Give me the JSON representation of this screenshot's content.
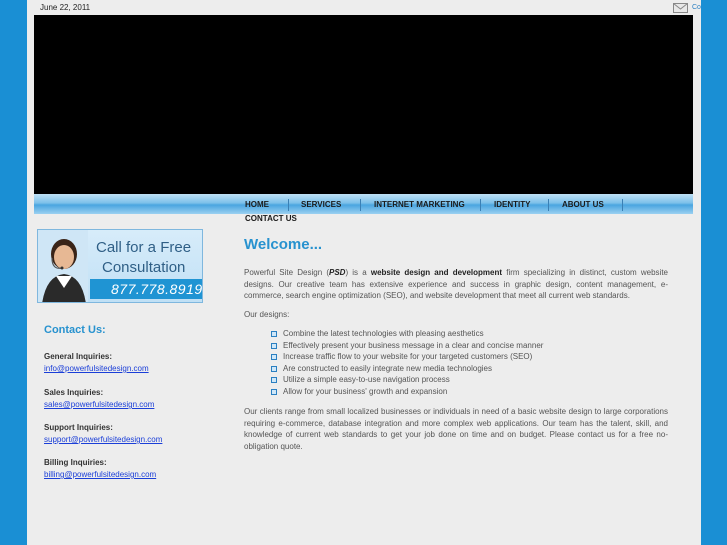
{
  "header": {
    "date": "June 22, 2011",
    "top_link": "Co"
  },
  "nav": {
    "items": [
      "HOME",
      "SERVICES",
      "INTERNET MARKETING",
      "IDENTITY",
      "ABOUT US",
      "CONTACT US"
    ]
  },
  "callout": {
    "line1": "Call for a Free",
    "line2": "Consultation",
    "phone": "877.778.8919"
  },
  "sidebar": {
    "heading": "Contact Us:",
    "inquiries": [
      {
        "label": "General Inquiries:",
        "email": "info@powerfulsitedesign.com"
      },
      {
        "label": "Sales Inquiries:",
        "email": "sales@powerfulsitedesign.com"
      },
      {
        "label": "Support Inquiries:",
        "email": "support@powerfulsitedesign.com"
      },
      {
        "label": "Billing Inquiries:",
        "email": "billing@powerfulsitedesign.com"
      }
    ]
  },
  "main": {
    "title": "Welcome...",
    "intro": {
      "p1": "Powerful Site Design (",
      "psd": "PSD",
      "p2": ") is a ",
      "bold": "website design and development",
      "p3": " firm specializing in distinct, custom website designs.  Our creative team has extensive experience and success in graphic design, content management, e-commerce, search engine optimization (SEO), and website development that meet all current web standards."
    },
    "designs_label": "Our designs:",
    "designs": [
      "Combine the latest technologies with pleasing aesthetics",
      "Effectively present your business message in a clear and concise manner",
      "Increase traffic flow to your website for your targeted customers (SEO)",
      "Are constructed to easily integrate new media technologies",
      "Utilize a simple easy-to-use navigation process",
      "Allow for your business' growth and expansion"
    ],
    "closing": "Our clients range from small localized businesses or individuals in need of a basic website design to large corporations requiring e-commerce, database integration and more complex web applications. Our team has the talent, skill, and knowledge of current web standards to get your job done on time and on budget. Please contact us for a free no-obligation quote."
  },
  "colors": {
    "outer_bg": "#1a8fd4",
    "page_bg": "#ededed",
    "accent": "#2792cf",
    "link": "#1a3ed8"
  }
}
